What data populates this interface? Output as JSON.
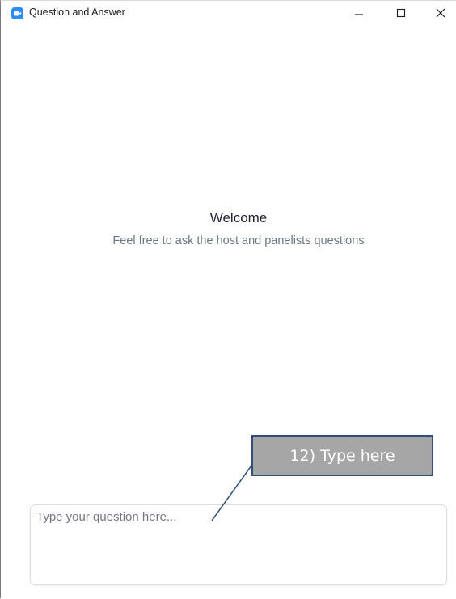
{
  "window": {
    "title": "Question and Answer",
    "icons": {
      "app": "zoom-app-icon",
      "minimize": "minimize-icon",
      "maximize": "maximize-icon",
      "close": "close-icon"
    },
    "accent_color": "#2d8cff"
  },
  "main": {
    "welcome_title": "Welcome",
    "welcome_subtitle": "Feel free to ask the host and panelists questions"
  },
  "composer": {
    "value": "",
    "placeholder": "Type your question here..."
  },
  "annotation": {
    "label": "12) Type here",
    "fill_color": "#a6a6a6",
    "border_color": "#2f4f7f"
  }
}
